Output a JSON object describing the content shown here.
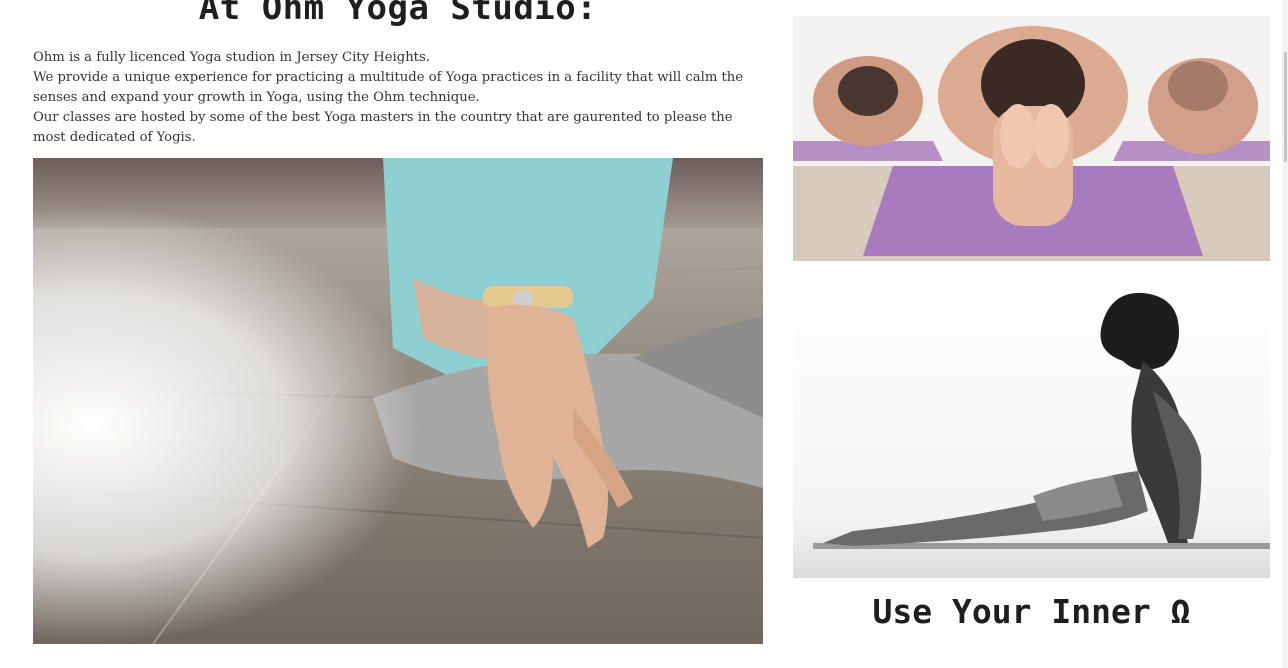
{
  "main": {
    "heading": "At Ohm Yoga Studio:",
    "intro": [
      "Ohm is a fully licenced Yoga studion in Jersey City Heights.",
      "We provide a unique experience for practicing a multitude of Yoga practices in a facility that will calm the senses and expand your growth in Yoga, using the Ohm technique.",
      "Our classes are hosted by some of the best Yoga masters in the country that are gaurented to please the most dedicated of Yogis."
    ]
  },
  "sidebar": {
    "tagline": "Use Your Inner Ω"
  },
  "colors": {
    "background": "#ffffff",
    "text": "#2a2a2a",
    "mat_purple": "#a77bbd",
    "floor_wood": "#8a7f74",
    "shirt_teal": "#8ecfd2"
  }
}
